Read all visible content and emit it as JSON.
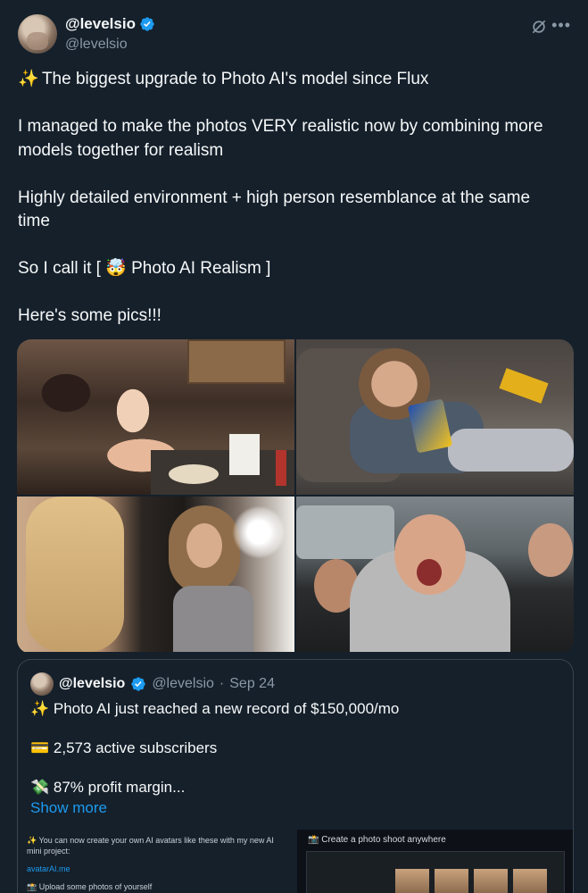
{
  "author": {
    "display_name": "@levelsio",
    "handle": "@levelsio"
  },
  "tweet": {
    "paragraphs": [
      {
        "emoji": "✨",
        "text": "The biggest upgrade to Photo AI's model since Flux"
      },
      {
        "emoji": "",
        "text": "I managed to make the photos VERY realistic now by combining more models together for realism"
      },
      {
        "emoji": "",
        "text": "Highly detailed environment + high person resemblance at the same time"
      },
      {
        "emoji": "",
        "text": "So I call it [ 🤯 Photo AI Realism ]"
      },
      {
        "emoji": "",
        "text": "Here's some pics!!!"
      }
    ]
  },
  "media": {
    "count": 4
  },
  "quoted_tweet": {
    "display_name": "@levelsio",
    "handle": "@levelsio",
    "separator": "·",
    "date": "Sep 24",
    "lines": [
      "✨ Photo AI just reached a new record of $150,000/mo",
      "💳 2,573 active subscribers",
      "💸 87% profit margin..."
    ],
    "show_more": "Show more",
    "preview_left": {
      "line1": "✨ You can now create your own AI avatars like these with my new AI mini project:",
      "link": "avatarAI.me",
      "line2": "📸 Upload some photos of yourself"
    },
    "preview_right": {
      "title": "📸 Create a photo shoot anywhere"
    }
  },
  "colors": {
    "background": "#15202b",
    "text": "#f7f9f9",
    "secondary_text": "#8b98a5",
    "link": "#1d9bf0",
    "border": "#38444d"
  }
}
